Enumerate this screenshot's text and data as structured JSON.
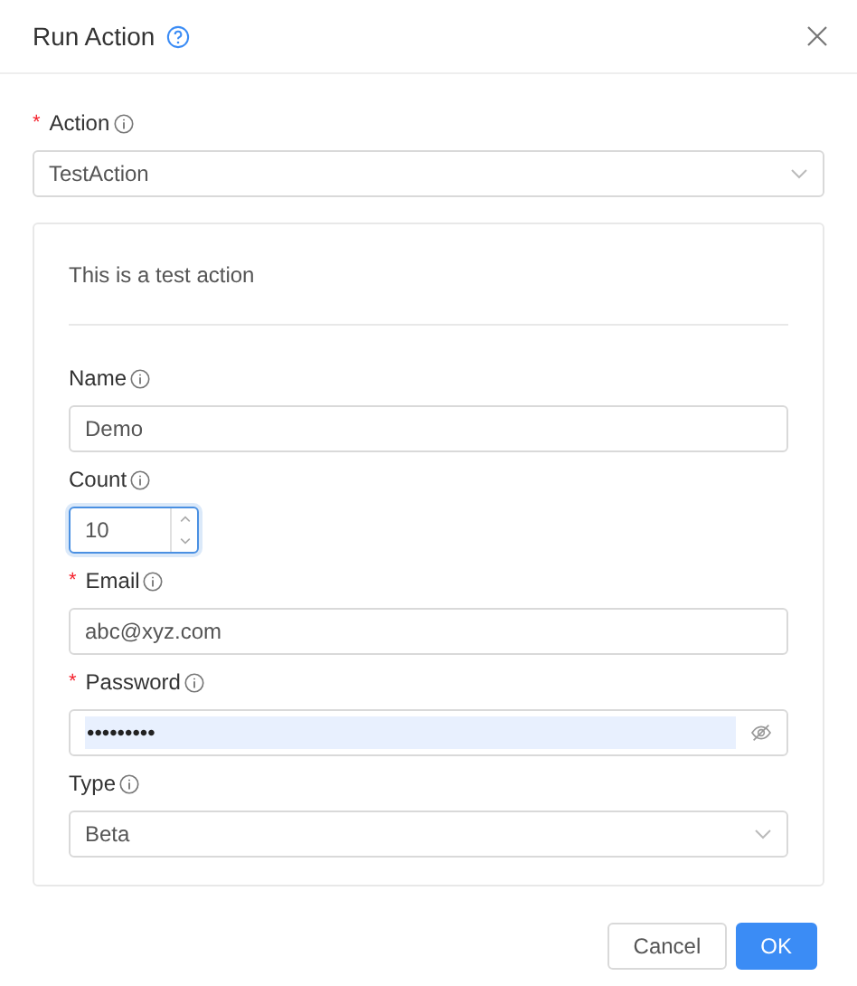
{
  "dialog": {
    "title": "Run Action"
  },
  "action": {
    "label": "Action",
    "required_mark": "*",
    "value": "TestAction"
  },
  "description": "This is a test action",
  "fields": [
    {
      "kind": "text",
      "label": "Name",
      "value": "Demo",
      "focused": false
    },
    {
      "kind": "number",
      "label": "Count",
      "value": "10",
      "focused": true
    },
    {
      "kind": "text",
      "label": "Email",
      "required_mark": "*",
      "value": "abc@xyz.com",
      "focused": false
    },
    {
      "kind": "password",
      "label": "Password",
      "required_mark": "*",
      "value": "•••••••••",
      "autofilled": true,
      "focused": false
    },
    {
      "kind": "select",
      "label": "Type",
      "value": "Beta",
      "focused": false
    }
  ],
  "buttons": [
    {
      "label": "Cancel",
      "primary": false
    },
    {
      "label": "OK",
      "primary": true
    }
  ]
}
